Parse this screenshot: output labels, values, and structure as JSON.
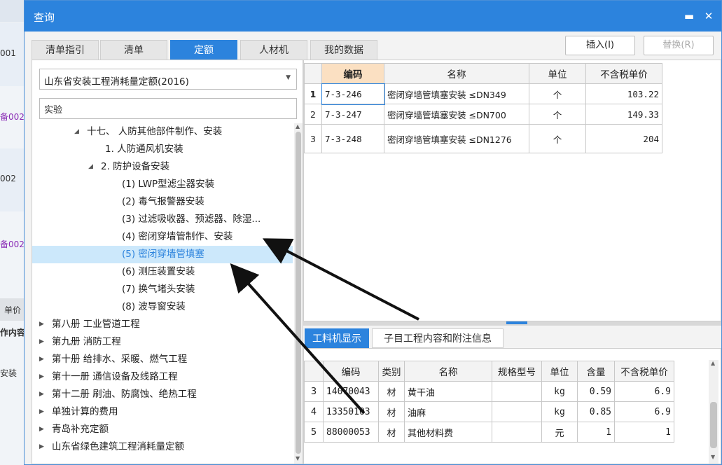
{
  "background_app": {
    "cells": [
      "001",
      "备002",
      "002",
      "备002",
      "单价",
      "作内容",
      "安装"
    ]
  },
  "dialog": {
    "title": "查询",
    "minimize_glyph": "▬",
    "close_glyph": "✕"
  },
  "tabs": [
    "清单指引",
    "清单",
    "定额",
    "人材机",
    "我的数据"
  ],
  "active_tab": "定额",
  "buttons": {
    "insert": "插入(I)",
    "replace": "替换(R)"
  },
  "library": {
    "selected": "山东省安装工程消耗量定额(2016)"
  },
  "search": {
    "value": "实验"
  },
  "tree": [
    {
      "label": "十七、 人防其他部件制作、安装",
      "expanded": true
    },
    {
      "label": "1. 人防通风机安装"
    },
    {
      "label": "2. 防护设备安装",
      "expanded": true
    },
    {
      "label": "(1) LWP型滤尘器安装"
    },
    {
      "label": "(2) 毒气报警器安装"
    },
    {
      "label": "(3) 过滤吸收器、预滤器、除湿..."
    },
    {
      "label": "(4) 密闭穿墙管制作、安装"
    },
    {
      "label": "(5) 密闭穿墙管填塞",
      "selected": true
    },
    {
      "label": "(6) 测压装置安装"
    },
    {
      "label": "(7) 换气堵头安装"
    },
    {
      "label": "(8) 波导窗安装"
    },
    {
      "label": "第八册 工业管道工程"
    },
    {
      "label": "第九册 消防工程"
    },
    {
      "label": "第十册 给排水、采暖、燃气工程"
    },
    {
      "label": "第十一册 通信设备及线路工程"
    },
    {
      "label": "第十二册 刷油、防腐蚀、绝热工程"
    },
    {
      "label": "单独计算的费用"
    },
    {
      "label": "青岛补充定额"
    },
    {
      "label": "山东省绿色建筑工程消耗量定额"
    }
  ],
  "quota_table": {
    "headers": [
      "编码",
      "名称",
      "单位",
      "不含税单价"
    ],
    "rows": [
      {
        "no": "1",
        "code": "7-3-246",
        "name": "密闭穿墙管填塞安装 ≤DN349",
        "unit": "个",
        "price": "103.22"
      },
      {
        "no": "2",
        "code": "7-3-247",
        "name": "密闭穿墙管填塞安装 ≤DN700",
        "unit": "个",
        "price": "149.33"
      },
      {
        "no": "3",
        "code": "7-3-248",
        "name": "密闭穿墙管填塞安装 ≤DN1276",
        "unit": "个",
        "price": "204"
      }
    ]
  },
  "bottom_tabs": [
    "工料机显示",
    "子目工程内容和附注信息"
  ],
  "material_table": {
    "headers": [
      "编码",
      "类别",
      "名称",
      "规格型号",
      "单位",
      "含量",
      "不含税单价"
    ],
    "rows": [
      {
        "no": "3",
        "code": "14070043",
        "type": "材",
        "name": "黄干油",
        "spec": "",
        "unit": "kg",
        "qty": "0.59",
        "price": "6.9"
      },
      {
        "no": "4",
        "code": "13350103",
        "type": "材",
        "name": "油麻",
        "spec": "",
        "unit": "kg",
        "qty": "0.85",
        "price": "6.9"
      },
      {
        "no": "5",
        "code": "88000053",
        "type": "材",
        "name": "其他材料费",
        "spec": "",
        "unit": "元",
        "qty": "1",
        "price": "1"
      }
    ]
  },
  "colors": {
    "accent": "#2c83dd",
    "selection": "#cce8fb",
    "arrow": "#111111"
  }
}
